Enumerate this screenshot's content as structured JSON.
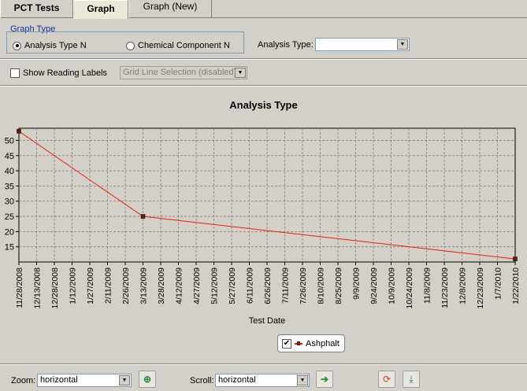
{
  "tabs": [
    {
      "label": "PCT Tests"
    },
    {
      "label": "Graph"
    },
    {
      "label": "Graph (New)"
    }
  ],
  "graph_type": {
    "title": "Graph Type",
    "options": [
      {
        "label": "Analysis Type N",
        "selected": true
      },
      {
        "label": "Chemical Component N",
        "selected": false
      }
    ],
    "analysis_type_label": "Analysis Type:",
    "analysis_type_value": ""
  },
  "options_row": {
    "show_reading_labels": "Show Reading Labels",
    "show_reading_labels_checked": false,
    "grid_line_selection": "Grid Line Selection (disabled)"
  },
  "chart_data": {
    "type": "line",
    "title": "Analysis Type",
    "xlabel": "Test Date",
    "ylabel": "",
    "ylim": [
      10,
      54
    ],
    "yticks": [
      15,
      20,
      25,
      30,
      35,
      40,
      45,
      50
    ],
    "xticks": [
      "11/28/2008",
      "12/13/2008",
      "12/28/2008",
      "1/12/2009",
      "1/27/2009",
      "2/11/2009",
      "2/26/2009",
      "3/13/2009",
      "3/28/2009",
      "4/12/2009",
      "4/27/2009",
      "5/12/2009",
      "5/27/2009",
      "6/11/2009",
      "6/26/2009",
      "7/11/2009",
      "7/26/2009",
      "8/10/2009",
      "8/25/2009",
      "9/9/2009",
      "9/24/2009",
      "10/9/2009",
      "10/24/2009",
      "11/8/2009",
      "11/23/2009",
      "12/8/2009",
      "12/23/2009",
      "1/7/2010",
      "1/22/2010"
    ],
    "series": [
      {
        "name": "Ashphalt",
        "color": "#e0201a",
        "points": [
          {
            "x": "11/28/2008",
            "y": 53
          },
          {
            "x": "3/13/2009",
            "y": 25
          },
          {
            "x": "1/22/2010",
            "y": 11
          }
        ]
      }
    ],
    "grid": true,
    "legend": {
      "placement": "bottom-center",
      "checked": true
    }
  },
  "bottom": {
    "zoom_label": "Zoom:",
    "zoom_value": "horizontal",
    "scroll_label": "Scroll:",
    "scroll_value": "horizontal"
  }
}
